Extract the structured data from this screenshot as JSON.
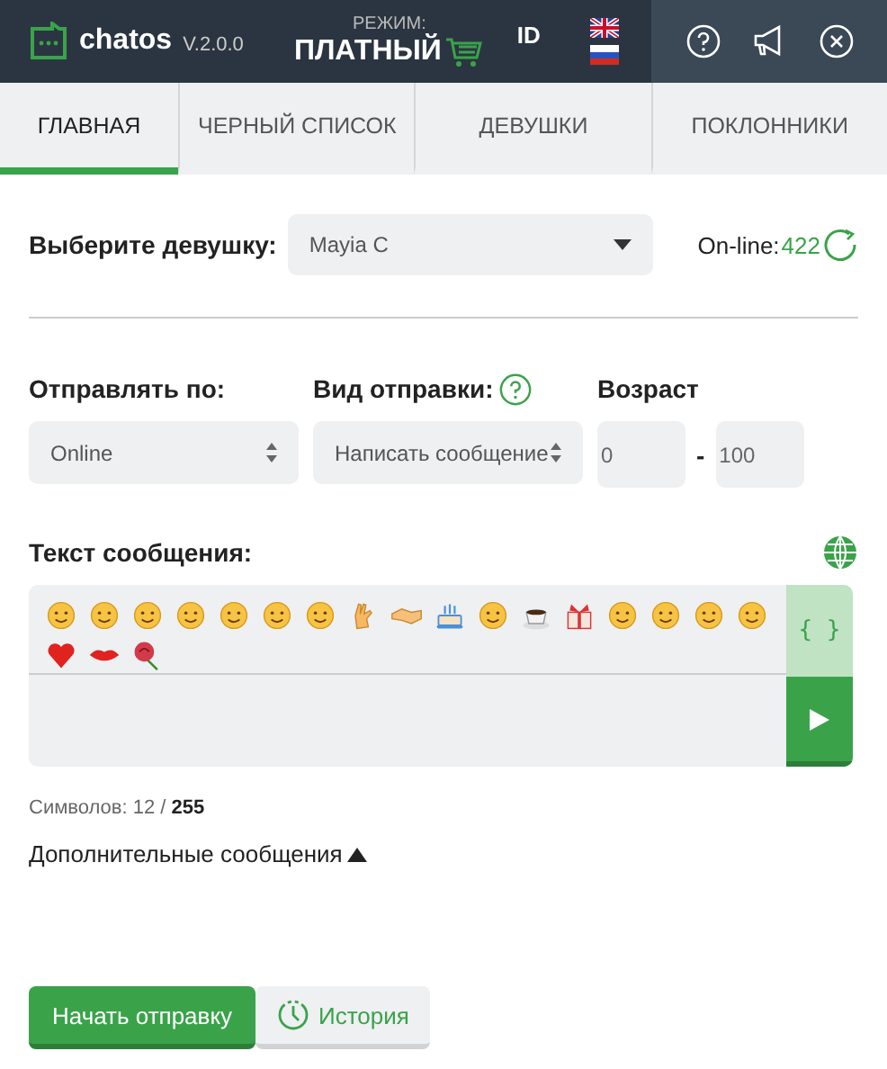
{
  "header": {
    "app_name": "chatos",
    "version": "V.2.0.0",
    "mode_label": "РЕЖИМ:",
    "mode": "ПЛАТНЫЙ",
    "id_label": "ID"
  },
  "tabs": [
    {
      "label": "ГЛАВНАЯ",
      "selected": true
    },
    {
      "label": "ЧЕРНЫЙ СПИСОК",
      "selected": false
    },
    {
      "label": "ДЕВУШКИ",
      "selected": false
    },
    {
      "label": "ПОКЛОННИКИ",
      "selected": false
    }
  ],
  "girl": {
    "label": "Выберите девушку:",
    "value": "Mayia C",
    "online_label": "On-line:",
    "online_count": "422"
  },
  "send_by": {
    "label": "Отправлять по:",
    "value": "Online"
  },
  "send_type": {
    "label": "Вид отправки:",
    "value": "Написать сообщение"
  },
  "age": {
    "label": "Возраст",
    "from": "0",
    "separator": "-",
    "to": "100"
  },
  "message": {
    "label": "Текст сообщения:",
    "braces": "{ }",
    "counter": "Символов: 12 / **255**"
  },
  "extra": {
    "label": "Дополнительные сообщения",
    "expanded": true
  },
  "buttons": {
    "start": "Начать отправку",
    "history": "История"
  }
}
